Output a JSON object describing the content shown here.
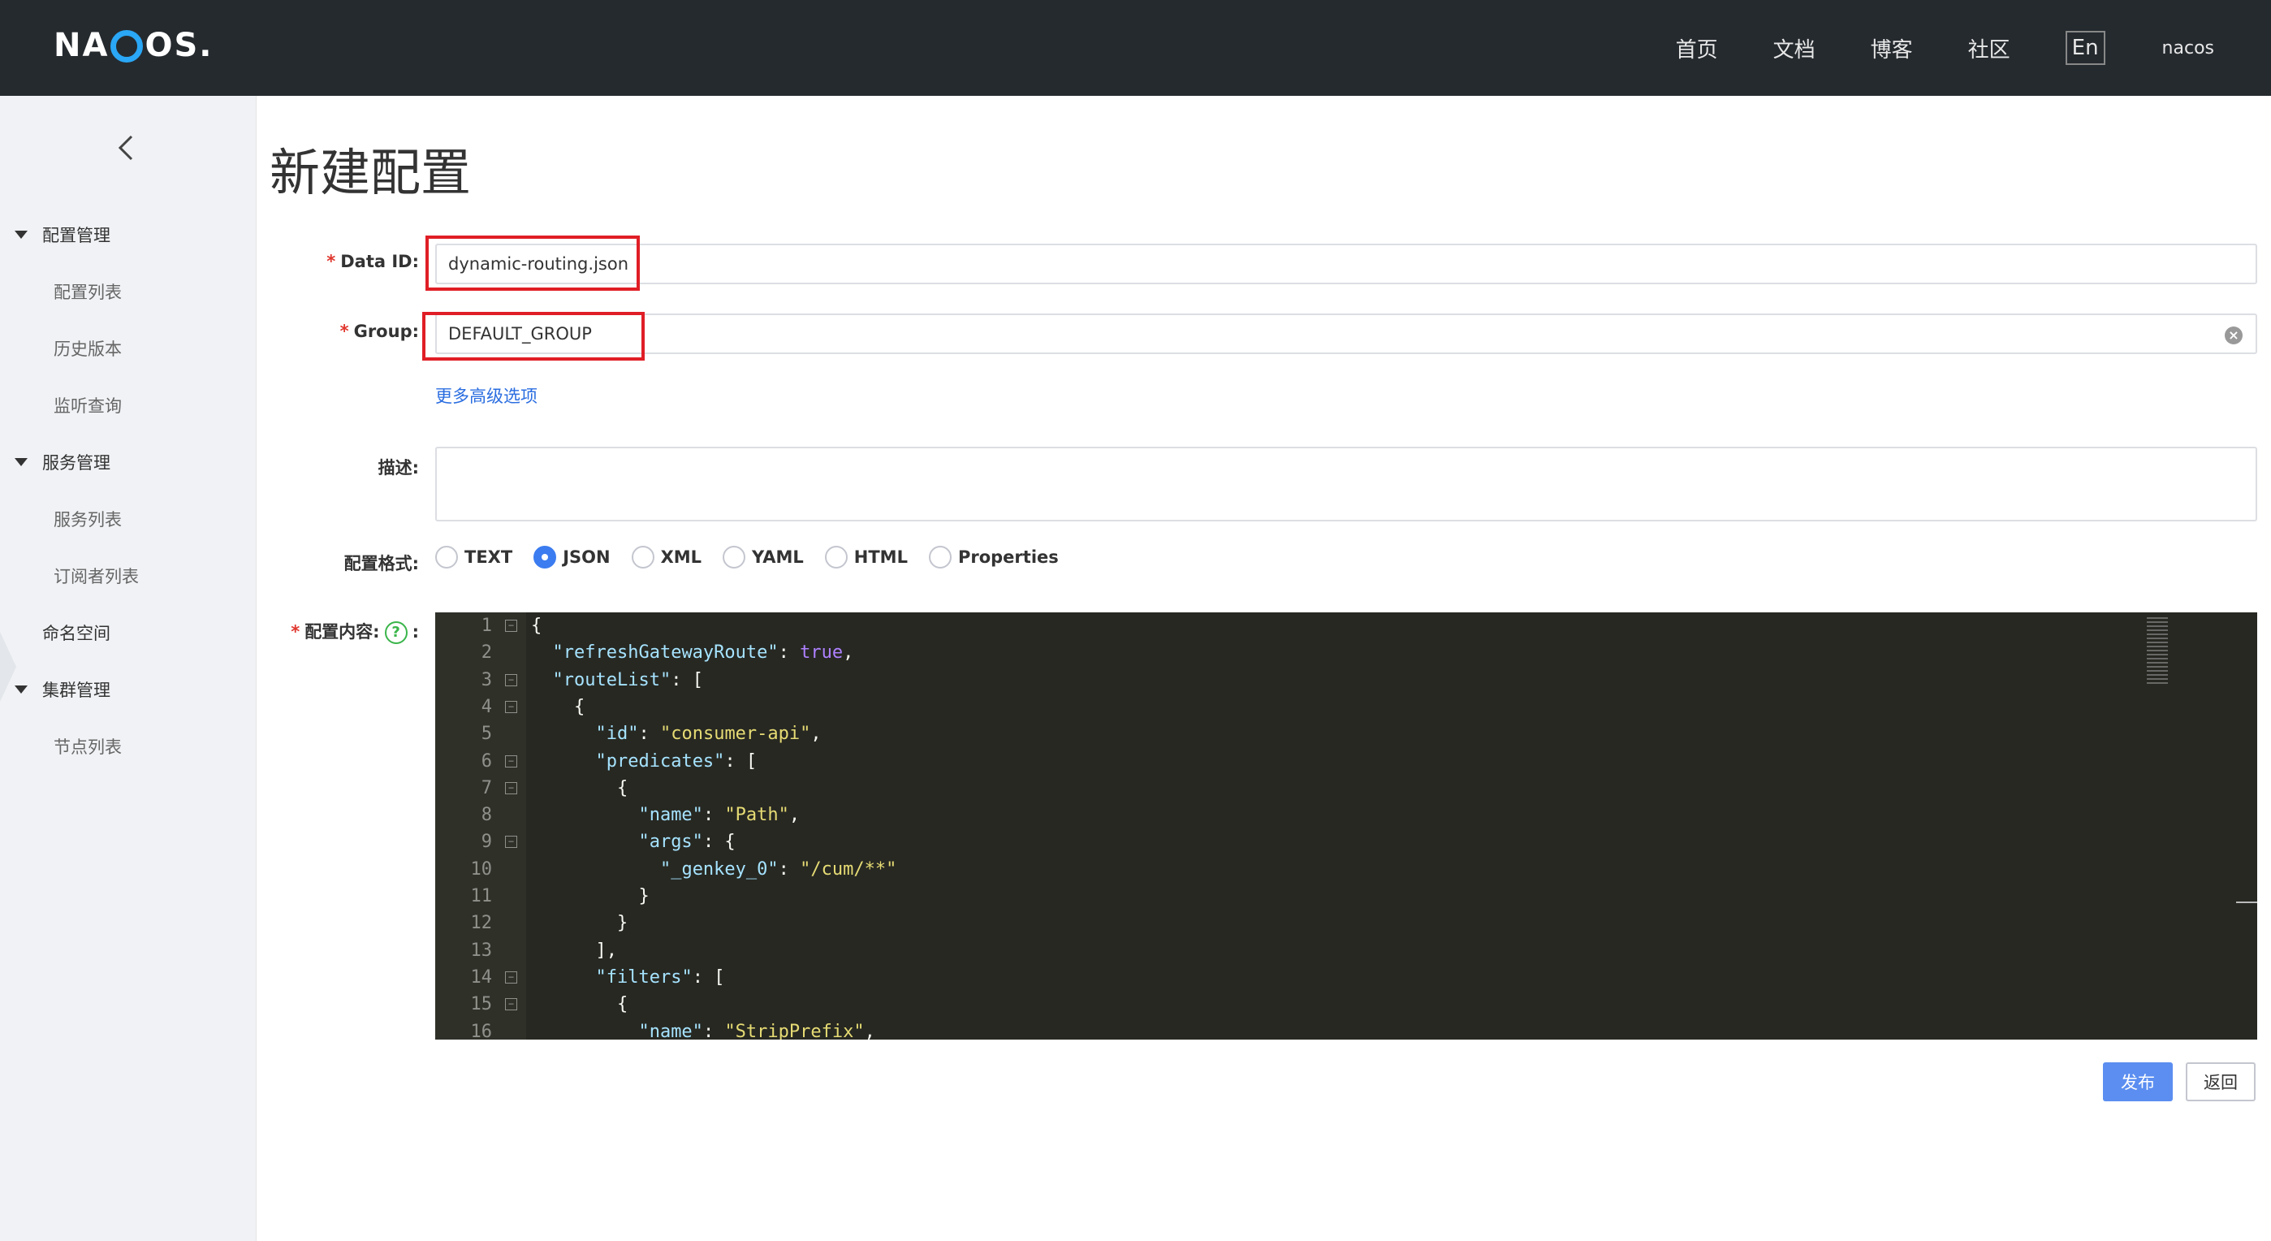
{
  "header": {
    "logo_text_left": "NA",
    "logo_text_right": "OS",
    "logo_dot": ".",
    "nav": [
      "首页",
      "文档",
      "博客",
      "社区"
    ],
    "lang": "En",
    "user": "nacos"
  },
  "sidebar": {
    "groups": [
      {
        "label": "配置管理",
        "items": [
          "配置列表",
          "历史版本",
          "监听查询"
        ]
      },
      {
        "label": "服务管理",
        "items": [
          "服务列表",
          "订阅者列表"
        ]
      }
    ],
    "namespace": "命名空间",
    "cluster": {
      "label": "集群管理",
      "items": [
        "节点列表"
      ]
    }
  },
  "page": {
    "title": "新建配置"
  },
  "form": {
    "data_id_label": "Data ID:",
    "data_id_value": "dynamic-routing.json",
    "group_label": "Group:",
    "group_value": "DEFAULT_GROUP",
    "advanced_link": "更多高级选项",
    "desc_label": "描述:",
    "format_label": "配置格式:",
    "formats": [
      "TEXT",
      "JSON",
      "XML",
      "YAML",
      "HTML",
      "Properties"
    ],
    "selected_format": "JSON",
    "content_label": "配置内容:",
    "help_symbol": "?",
    "colon": ":"
  },
  "editor": {
    "lines": [
      "{",
      "  \"refreshGatewayRoute\": true,",
      "  \"routeList\": [",
      "    {",
      "      \"id\": \"consumer-api\",",
      "      \"predicates\": [",
      "        {",
      "          \"name\": \"Path\",",
      "          \"args\": {",
      "            \"_genkey_0\": \"/cum/**\"",
      "          }",
      "        }",
      "      ],",
      "      \"filters\": [",
      "        {",
      "          \"name\": \"StripPrefix\","
    ]
  },
  "actions": {
    "publish": "发布",
    "back": "返回"
  }
}
